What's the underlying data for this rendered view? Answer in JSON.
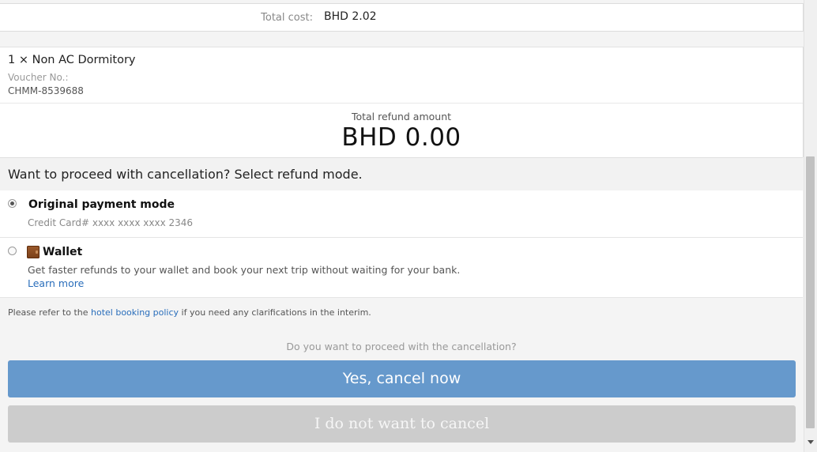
{
  "cost": {
    "label": "Total cost:",
    "value": "BHD 2.02"
  },
  "room": {
    "title": "1 × Non AC Dormitory",
    "voucher_label": "Voucher No.:",
    "voucher_value": "CHMM-8539688",
    "refund_label": "Total refund amount",
    "refund_amount": "BHD 0.00"
  },
  "refund_mode": {
    "heading": "Want to proceed with cancellation? Select refund mode.",
    "options": [
      {
        "title": "Original payment mode",
        "subtitle": "Credit Card# xxxx xxxx xxxx 2346",
        "selected": true
      },
      {
        "title": "Wallet",
        "icon": "wallet-icon",
        "description": "Get faster refunds to your wallet and book your next trip without waiting for your bank.",
        "link": "Learn more",
        "selected": false
      }
    ]
  },
  "policy": {
    "prefix": "Please refer to the ",
    "link": "hotel booking policy",
    "suffix": " if you need any clarifications in the interim."
  },
  "confirm": {
    "question": "Do you want to proceed with the cancellation?",
    "yes_label": "Yes, cancel now",
    "no_label": "I do not want to cancel"
  },
  "colors": {
    "primary_button": "#6699cc",
    "secondary_button": "#cccccc",
    "link": "#2a6ebb"
  }
}
